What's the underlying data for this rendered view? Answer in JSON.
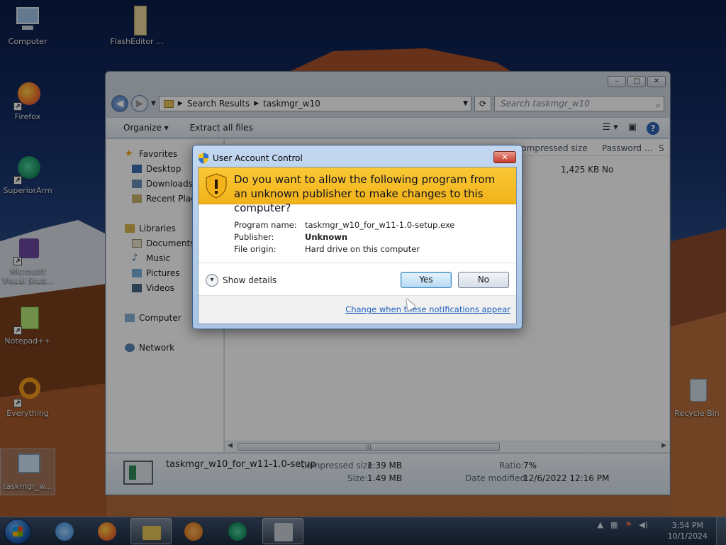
{
  "desktop": {
    "icons": [
      {
        "label": "Computer"
      },
      {
        "label": "FlashEditor ..."
      },
      {
        "label": "Firefox"
      },
      {
        "label": "SuperiorArm"
      },
      {
        "label": "Microsoft Visual Stud..."
      },
      {
        "label": "Notepad++"
      },
      {
        "label": "Everything"
      },
      {
        "label": "taskmgr_w..."
      },
      {
        "label": "Recycle Bin"
      }
    ]
  },
  "explorer": {
    "breadcrumb": [
      "Search Results",
      "taskmgr_w10"
    ],
    "search_placeholder": "Search taskmgr_w10",
    "toolbar": {
      "organize": "Organize ▾",
      "extract": "Extract all files"
    },
    "nav": {
      "favorites": "Favorites",
      "desktop": "Desktop",
      "downloads": "Downloads",
      "recent": "Recent Places",
      "libraries": "Libraries",
      "documents": "Documents",
      "music": "Music",
      "pictures": "Pictures",
      "videos": "Videos",
      "computer": "Computer",
      "network": "Network"
    },
    "columns": {
      "compressed_size": "Compressed size",
      "password": "Password ...",
      "s": "S"
    },
    "row": {
      "compressed_size": "1,425 KB",
      "password": "No"
    },
    "details": {
      "filename": "taskmgr_w10_for_w11-1.0-setup",
      "compressed_label": "Compressed size:",
      "compressed_value": "1.39 MB",
      "size_label": "Size:",
      "size_value": "1.49 MB",
      "ratio_label": "Ratio:",
      "ratio_value": "7%",
      "modified_label": "Date modified:",
      "modified_value": "12/6/2022 12:16 PM"
    }
  },
  "uac": {
    "title": "User Account Control",
    "question": "Do you want to allow the following program from an unknown publisher to make changes to this computer?",
    "fields": {
      "program_label": "Program name:",
      "program_value": "taskmgr_w10_for_w11-1.0-setup.exe",
      "publisher_label": "Publisher:",
      "publisher_value": "Unknown",
      "origin_label": "File origin:",
      "origin_value": "Hard drive on this computer"
    },
    "show_details": "Show details",
    "yes": "Yes",
    "no": "No",
    "change_link": "Change when these notifications appear"
  },
  "taskbar": {
    "clock_time": "3:54 PM",
    "clock_date": "10/1/2024"
  },
  "colors": {
    "uac_banner": "#f5be26",
    "link": "#1f5fbf",
    "taskbar": "#2a3b52"
  }
}
